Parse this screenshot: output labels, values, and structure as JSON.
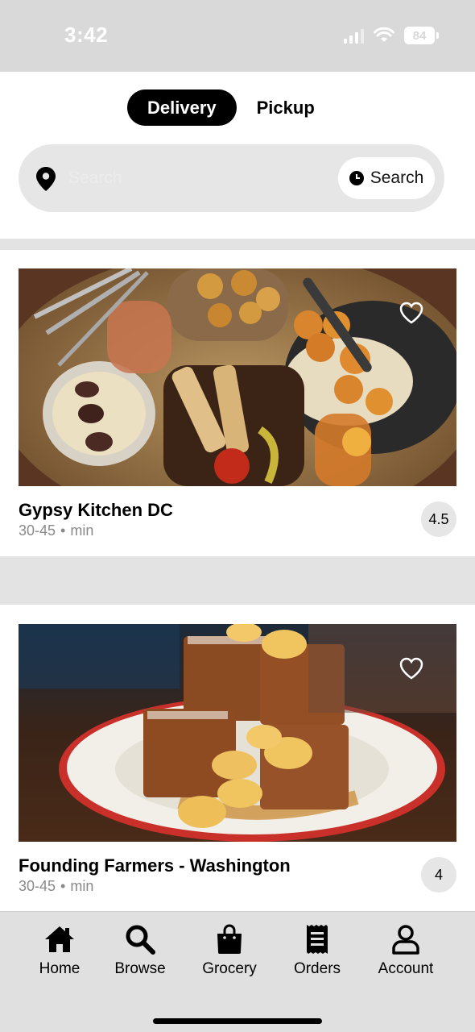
{
  "status_bar": {
    "time": "3:42",
    "battery": "84"
  },
  "mode_toggle": {
    "delivery_label": "Delivery",
    "pickup_label": "Pickup",
    "selected": "Delivery"
  },
  "search": {
    "placeholder": "Search",
    "button_label": "Search"
  },
  "restaurants": [
    {
      "name": "Gypsy Kitchen DC",
      "eta": "30-45",
      "separator": "•",
      "unit": "min",
      "rating": "4.5",
      "image": "food-platter-photo"
    },
    {
      "name": "Founding Farmers - Washington",
      "eta": "30-45",
      "separator": "•",
      "unit": "min",
      "rating": "4",
      "image": "french-toast-photo"
    }
  ],
  "tab_bar": {
    "items": [
      {
        "label": "Home",
        "icon": "home-icon"
      },
      {
        "label": "Browse",
        "icon": "search-icon"
      },
      {
        "label": "Grocery",
        "icon": "shopping-bag-icon"
      },
      {
        "label": "Orders",
        "icon": "receipt-icon"
      },
      {
        "label": "Account",
        "icon": "person-icon"
      }
    ]
  },
  "colors": {
    "accent": "#000000",
    "background": "#ffffff",
    "strip": "#e3e3e3",
    "tab_bar": "#e0e0e0"
  }
}
